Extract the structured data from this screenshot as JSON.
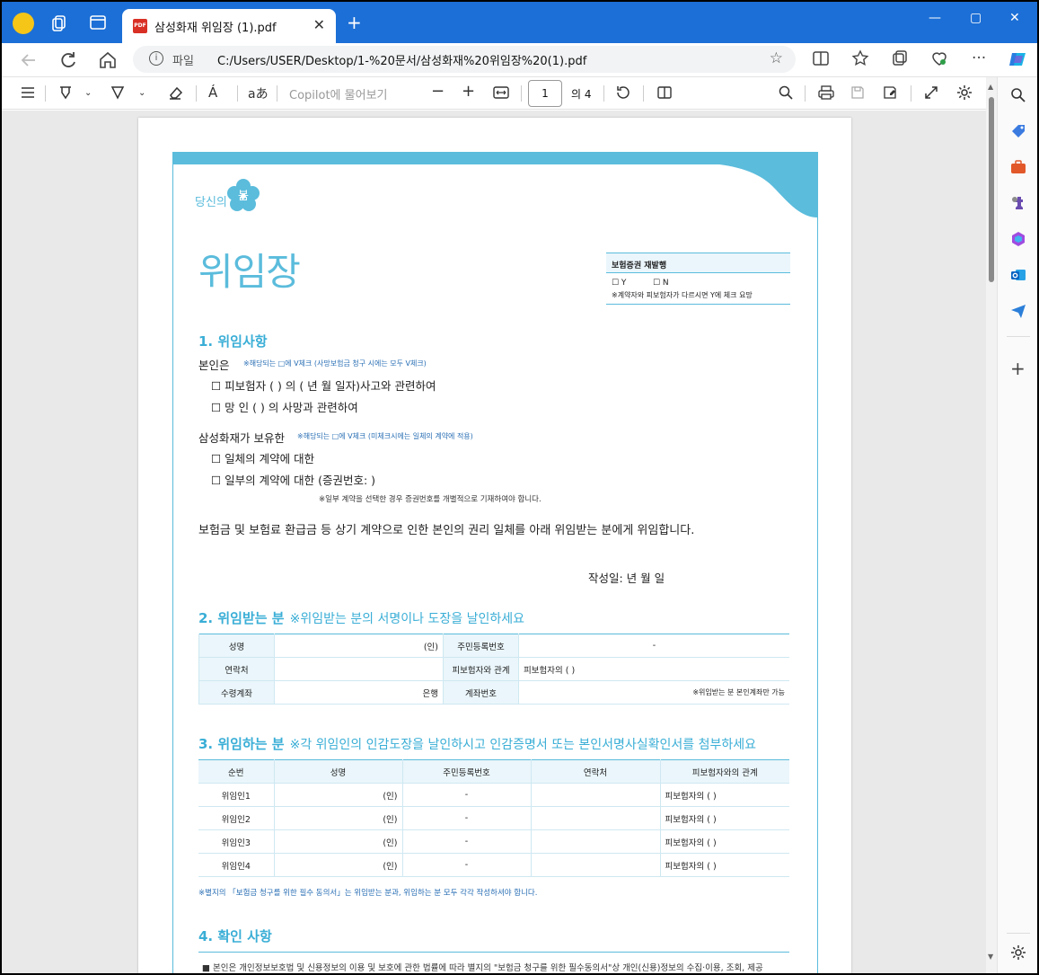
{
  "browser": {
    "tab_title": "삼성화재 위임장 (1).pdf",
    "pdf_badge": "PDF",
    "close_glyph": "✕",
    "new_tab_glyph": "+",
    "window_controls": {
      "minimize": "—",
      "maximize": "▢",
      "close": "✕"
    },
    "address_label": "파일",
    "url": "C:/Users/USER/Desktop/1-%20문서/삼성화재%20위임장%20(1).pdf"
  },
  "pdf_toolbar": {
    "copilot_placeholder": "Copilot에 물어보기",
    "current_page": "1",
    "page_total": "의 4",
    "read_aloud": "Á",
    "translate": "aあ",
    "zoom_out": "−",
    "zoom_in": "+"
  },
  "document": {
    "logo_text": "당신의",
    "logo_char": "봄",
    "title": "위임장",
    "reissue": {
      "header": "보험증권 재발행",
      "yes": "☐ Y",
      "no": "☐ N",
      "note": "※계약자와 피보험자가 다르시면 Y에 체크 요망"
    },
    "section1": {
      "heading": "1. 위임사항",
      "principal_label": "본인은",
      "principal_note": "※해당되는 □에 V체크 (사망보험금 청구 시에는 모두 V체크)",
      "insured_line": "☐ 피보험자 (                                   ) 의  (                    년          월          일자)사고와 관련하여",
      "deceased_line": "☐ 망       인 (                                   ) 의 사망과 관련하여",
      "holder_label": "삼성화재가 보유한",
      "holder_note": "※해당되는 □에 V체크 (미체크시에는 일체의 계약에 적용)",
      "all_contracts": "☐ 일체의 계약에 대한",
      "some_contracts": "☐ 일부의 계약에 대한 (증권번호:                                                                          )",
      "some_note": "※일부 계약을 선택한 경우 증권번호를 개별적으로 기재하여야 합니다.",
      "delegation_statement": "보험금 및 보험료 환급금 등 상기 계약으로 인한 본인의 권리 일체를 아래 위임받는 분에게 위임합니다.",
      "date_line": "작성일:                   년          월          일"
    },
    "section2": {
      "heading": "2. 위임받는 분",
      "heading_note": "※위임받는 분의 서명이나 도장을 날인하세요",
      "rows": [
        {
          "label": "성명",
          "value": "(인)",
          "label2": "주민등록번호",
          "value2": "-"
        },
        {
          "label": "연락처",
          "value": "",
          "label2": "피보험자와 관계",
          "value2": "피보험자의 (                                                        )"
        },
        {
          "label": "수령계좌",
          "value": "은행",
          "label2": "계좌번호",
          "value2": "※위임받는 분 본인계좌만 가능"
        }
      ]
    },
    "section3": {
      "heading": "3. 위임하는 분",
      "heading_note": "※각 위임인의 인감도장을 날인하시고 인감증명서 또는 본인서명사실확인서를 첨부하세요",
      "columns": [
        "순번",
        "성명",
        "주민등록번호",
        "연락처",
        "피보험자와의 관계"
      ],
      "rows": [
        {
          "no": "위임인1",
          "seal": "(인)",
          "rrn": "-",
          "relation": "피보험자의 (                            )"
        },
        {
          "no": "위임인2",
          "seal": "(인)",
          "rrn": "-",
          "relation": "피보험자의 (                            )"
        },
        {
          "no": "위임인3",
          "seal": "(인)",
          "rrn": "-",
          "relation": "피보험자의 (                            )"
        },
        {
          "no": "위임인4",
          "seal": "(인)",
          "rrn": "-",
          "relation": "피보험자의 (                            )"
        }
      ],
      "footnote": "※별지의 「보험금 청구를 위한 필수 동의서」는 위임받는 분과, 위임하는 분 모두 각각 작성하셔야 합니다."
    },
    "section4": {
      "heading": "4. 확인 사항",
      "first_line": "■ 본인은 개인정보보호법 및 신용정보의 이용 및 보호에 관한 법률에 따라 별지의 \"보험금 청구를 위한 필수동의서\"상 개인(신용)정보의 수집·이용, 조회, 제공"
    }
  },
  "colors": {
    "titlebar": "#1c6fd6",
    "accent": "#5bbcdc",
    "heading": "#3aaed6"
  }
}
